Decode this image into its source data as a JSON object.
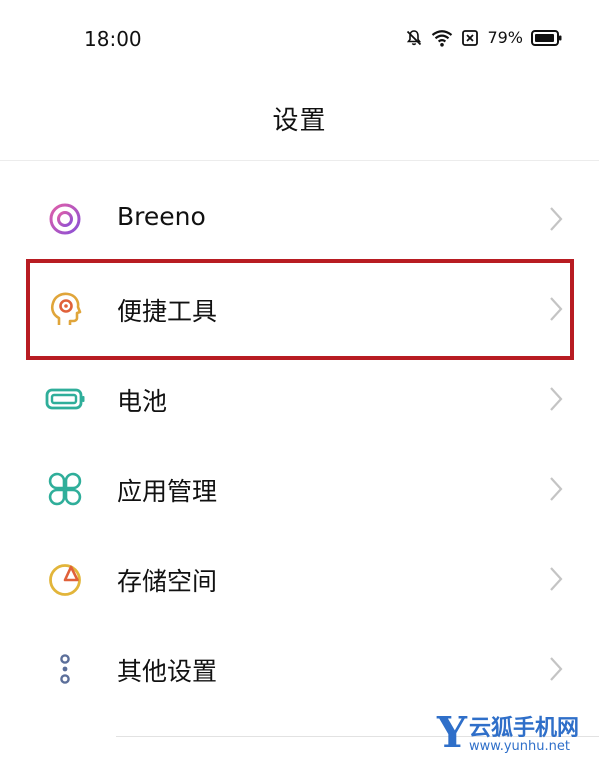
{
  "status_bar": {
    "time": "18:00",
    "battery_percent": "79%",
    "icons": [
      "bell-off-icon",
      "wifi-icon",
      "sim-off-icon",
      "battery-icon"
    ]
  },
  "header": {
    "title": "设置"
  },
  "settings": {
    "items": [
      {
        "label": "Breeno",
        "icon": "breeno-icon",
        "color": "#a855c9"
      },
      {
        "label": "便捷工具",
        "icon": "convenience-tools-icon",
        "color": "#e0a53a"
      },
      {
        "label": "电池",
        "icon": "battery-settings-icon",
        "color": "#2fae9a"
      },
      {
        "label": "应用管理",
        "icon": "app-management-icon",
        "color": "#2fae9a"
      },
      {
        "label": "存储空间",
        "icon": "storage-icon",
        "color": "#e2b53a"
      },
      {
        "label": "其他设置",
        "icon": "other-settings-icon",
        "color": "#5c6f9a"
      }
    ],
    "highlighted_item": "便捷工具",
    "highlight_color": "#b81c22"
  },
  "watermark": {
    "logo_letter": "Y",
    "brand": "云狐手机网",
    "url": "www.yunhu.net"
  }
}
